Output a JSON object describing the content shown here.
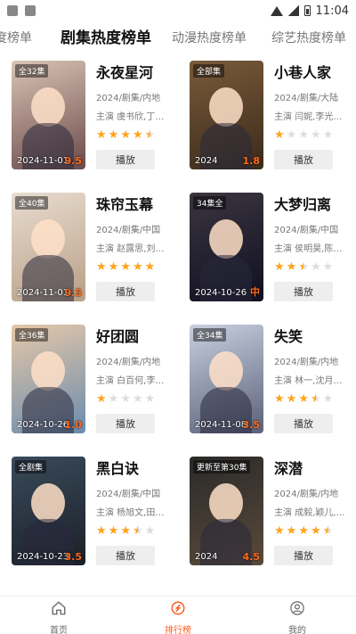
{
  "status": {
    "time": "11:04"
  },
  "tabs": [
    {
      "label": "度榜单",
      "active": false
    },
    {
      "label": "剧集热度榜单",
      "active": true
    },
    {
      "label": "动漫热度榜单",
      "active": false
    },
    {
      "label": "综艺热度榜单",
      "active": false
    }
  ],
  "play_label": "播放",
  "items": [
    {
      "title": "永夜星河",
      "meta": "2024/剧集/内地",
      "cast": "主演 虞书欣,丁…",
      "badge": "全32集",
      "date": "2024-11-01",
      "score": "9.5",
      "stars": 4.5,
      "colors": [
        "#d9c4b5",
        "#6b4a4a"
      ]
    },
    {
      "title": "小巷人家",
      "meta": "2024/剧集/大陆",
      "cast": "主演 闫妮,李光…",
      "badge": "全部集",
      "date": "2024",
      "score": "1.8",
      "stars": 1,
      "colors": [
        "#7a5b3a",
        "#3a2a1a"
      ]
    },
    {
      "title": "珠帘玉幕",
      "meta": "2024/剧集/中国",
      "cast": "主演 赵露思,刘…",
      "badge": "全40集",
      "date": "2024-11-01",
      "score": "9.5",
      "stars": 5,
      "colors": [
        "#e8dcd0",
        "#b89f86"
      ]
    },
    {
      "title": "大梦归离",
      "meta": "2024/剧集/中国",
      "cast": "主演 侯明昊,陈…",
      "badge": "34集全",
      "date": "2024-10-26",
      "score": "中",
      "stars": 2.5,
      "colors": [
        "#3a3540",
        "#101020"
      ]
    },
    {
      "title": "好团圆",
      "meta": "2024/剧集/内地",
      "cast": "主演 白百何,李…",
      "badge": "全36集",
      "date": "2024-10-26",
      "score": "1.0",
      "stars": 1,
      "colors": [
        "#e6c8a8",
        "#6b8cae"
      ]
    },
    {
      "title": "失笑",
      "meta": "2024/剧集/内地",
      "cast": "主演 林一,沈月…",
      "badge": "全34集",
      "date": "2024-11-08",
      "score": "3.5",
      "stars": 3.5,
      "colors": [
        "#c8d0e0",
        "#5a6078"
      ]
    },
    {
      "title": "黑白诀",
      "meta": "2024/剧集/中国",
      "cast": "主演 杨旭文,田…",
      "badge": "全剧集",
      "date": "2024-10-23",
      "score": "3.5",
      "stars": 3.5,
      "colors": [
        "#3a4a5a",
        "#1a2028"
      ]
    },
    {
      "title": "深潜",
      "meta": "2024/剧集/内地",
      "cast": "主演 成毅,颖儿,…",
      "badge": "更新至第30集",
      "date": "2024",
      "score": "4.5",
      "stars": 4.5,
      "colors": [
        "#2a2a2a",
        "#5a4a3a"
      ]
    }
  ],
  "nav": [
    {
      "label": "首页",
      "icon": "home-icon",
      "active": false
    },
    {
      "label": "排行榜",
      "icon": "ranking-icon",
      "active": true
    },
    {
      "label": "我的",
      "icon": "profile-icon",
      "active": false
    }
  ],
  "colors": {
    "accent": "#ff5a1f",
    "star": "#ffa31a",
    "star_off": "#dddddd"
  }
}
